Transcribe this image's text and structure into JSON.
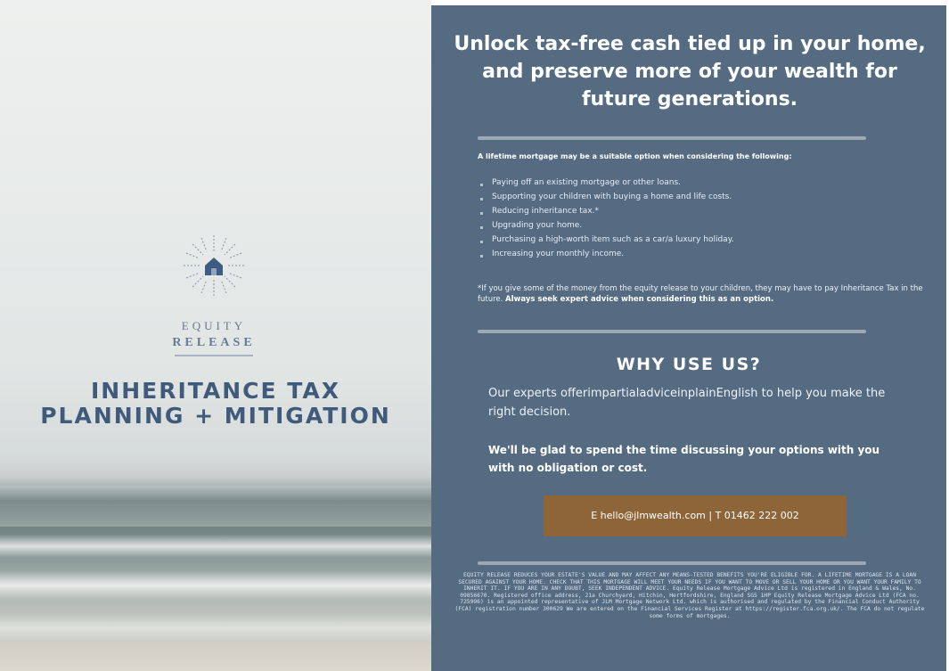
{
  "left_panel": {
    "logo": {
      "icon": "sunburst-house-icon",
      "word1": "EQUITY",
      "word2": "RELEASE"
    },
    "title_line1": "INHERITANCE TAX",
    "title_line2": "PLANNING + MITIGATION"
  },
  "right_panel": {
    "headline": "Unlock tax-free cash tied up in your home, and preserve more of your wealth for future generations.",
    "intro": "A lifetime mortgage may be a suitable option when considering the following:",
    "bullets": [
      "Paying off an existing mortgage or other loans.",
      "Supporting your children with buying a home and life costs.",
      "Reducing inheritance tax.*",
      "Upgrading your home.",
      "Purchasing a high-worth item such as a car/a luxury holiday.",
      "Increasing your monthly income."
    ],
    "footnote_text": "*If you give some of the money from the equity release to your children, they may have to pay Inheritance Tax in the future.",
    "footnote_bold": "Always seek expert advice when considering this as an option.",
    "why_title": "WHY USE US?",
    "why_text": "Our experts offerimpartialadviceinplainEnglish to help you make the right decision.",
    "why_bold": "We'll be glad to spend the time discussing your options with you with no obligation or cost.",
    "contact": "E hello@jlmwealth.com | T 01462 222 002",
    "disclaimer": "EQUITY RELEASE REDUCES YOUR ESTATE'S VALUE AND MAY AFFECT ANY MEANS-TESTED BENEFITS YOU'RE ELIGIBLE FOR. A LIFETIME MORTGAGE IS A LOAN SECURED AGAINST YOUR HOME. CHECK THAT THIS MORTGAGE WILL MEET YOUR NEEDS IF YOU WANT TO MOVE OR SELL YOUR HOME OR YOU WANT YOUR FAMILY TO INHERIT IT. IF YOU ARE IN ANY DOUBT, SEEK INDEPENDENT ADVICE. Equity Release Mortgage Advice Ltd is registered in England & Wales, No. 09856670. Registered office address, 21a Churchyard, Hitchin, Hertfordshire, England SG5 1HP Equity Release Mortgage Advice Ltd (FCA no. 725996) is an appointed representative of JLM Mortgage Network Ltd. which is authorised and regulated by the Financial Conduct Authority (FCA) registration number 300629 We are entered on the Financial Services Register at https://register.fca.org.uk/. The FCA do not regulate some forms of mortgages."
  }
}
